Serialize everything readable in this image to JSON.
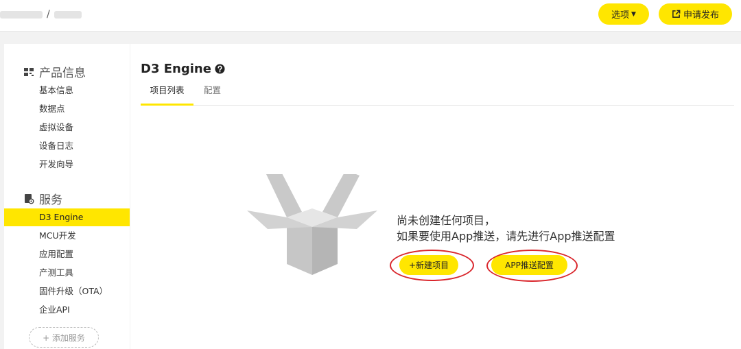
{
  "header": {
    "breadcrumb_separator": "/",
    "options_label": "选项",
    "publish_label": "申请发布"
  },
  "sidebar": {
    "product_group": {
      "title": "产品信息",
      "items": [
        "基本信息",
        "数据点",
        "虚拟设备",
        "设备日志",
        "开发向导"
      ]
    },
    "service_group": {
      "title": "服务",
      "items": [
        "D3 Engine",
        "MCU开发",
        "应用配置",
        "产测工具",
        "固件升级（OTA）",
        "企业API"
      ],
      "active_item": "D3 Engine"
    },
    "add_service_label": "+ 添加服务"
  },
  "main": {
    "title": "D3 Engine",
    "tabs": [
      "项目列表",
      "配置"
    ],
    "active_tab": "项目列表",
    "empty_state": {
      "line1": "尚未创建任何项目，",
      "line2": "如果要使用App推送，请先进行App推送配置"
    },
    "new_project_label": "+新建项目",
    "push_config_label": "APP推送配置"
  },
  "colors": {
    "accent": "#ffe600",
    "annotation_ring": "#d9252b",
    "background": "#f2f2f2"
  },
  "icons": {
    "options_caret": "caret-down-icon",
    "publish": "external-link-icon",
    "product_group": "grid-icon",
    "service_group": "service-icon",
    "help": "question-circle-icon",
    "empty_illustration": "open-box-icon"
  }
}
